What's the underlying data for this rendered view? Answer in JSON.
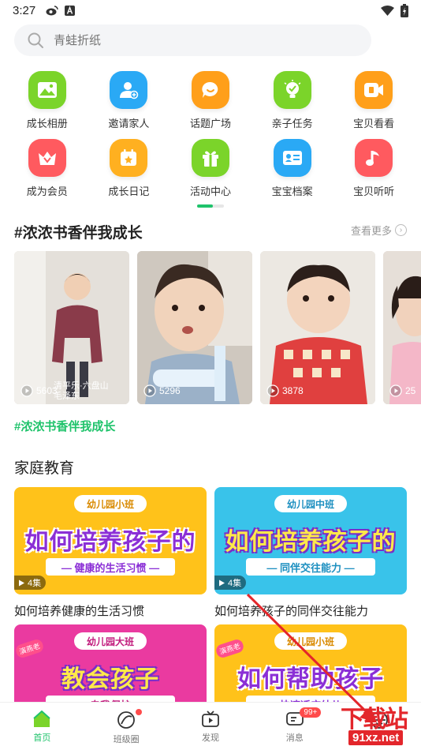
{
  "status_bar": {
    "time": "3:27"
  },
  "search": {
    "placeholder": "青蛙折纸"
  },
  "quick_grid": [
    {
      "label": "成长相册",
      "icon": "photo-album-icon",
      "color": "#7bd42a"
    },
    {
      "label": "邀请家人",
      "icon": "invite-family-icon",
      "color": "#2aa9f5"
    },
    {
      "label": "话题广场",
      "icon": "topic-square-icon",
      "color": "#ff9f1a"
    },
    {
      "label": "亲子任务",
      "icon": "parent-task-icon",
      "color": "#7bd42a"
    },
    {
      "label": "宝贝看看",
      "icon": "baby-watch-icon",
      "color": "#ff9f1a"
    },
    {
      "label": "成为会员",
      "icon": "vip-crown-icon",
      "color": "#ff5a5f"
    },
    {
      "label": "成长日记",
      "icon": "diary-calendar-icon",
      "color": "#ffb020"
    },
    {
      "label": "活动中心",
      "icon": "gift-icon",
      "color": "#7bd42a"
    },
    {
      "label": "宝宝档案",
      "icon": "profile-card-icon",
      "color": "#2aa9f5"
    },
    {
      "label": "宝贝听听",
      "icon": "music-note-icon",
      "color": "#ff5a5f"
    }
  ],
  "topic": {
    "title": "#浓浓书香伴我成长",
    "more_label": "查看更多",
    "tag_link": "#浓浓书香伴我成长",
    "videos": [
      {
        "views": "5603",
        "caption": "清平乐·六盘山 毛泽东",
        "bg": "#d8d2cc",
        "shirt": "#8a3b4a"
      },
      {
        "views": "5296",
        "caption": "",
        "bg": "#c9c3bb",
        "shirt": "#9bb1c8"
      },
      {
        "views": "3878",
        "caption": "",
        "bg": "#ddd8d0",
        "shirt": "#e0403f"
      },
      {
        "views": "25",
        "caption": "",
        "bg": "#d7cfc8",
        "shirt": "#f4b7c8"
      }
    ]
  },
  "family_edu": {
    "title": "家庭教育",
    "courses": [
      {
        "badge": "幼儿园小班",
        "big": "如何培养孩子的",
        "sub": "— 健康的生活习惯 —",
        "episodes": "4集",
        "title": "如何培养健康的生活习惯",
        "bg": "#ffc21a",
        "big_color": "#8b2fd6",
        "stamp": ""
      },
      {
        "badge": "幼儿园中班",
        "big": "如何培养孩子的",
        "sub": "— 同伴交往能力 —",
        "episodes": "4集",
        "title": "如何培养孩子的同伴交往能力",
        "bg": "#39c3ea",
        "big_color": "#ffe94a",
        "stamp": ""
      },
      {
        "badge": "幼儿园大班",
        "big": "教会孩子",
        "sub": "自我保护",
        "episodes": "",
        "title": "",
        "bg": "#ea3aa0",
        "big_color": "#ffe94a",
        "stamp": "演燕老"
      },
      {
        "badge": "幼儿园小班",
        "big": "如何帮助孩子",
        "sub": "快速适应幼儿",
        "episodes": "",
        "title": "",
        "bg": "#ffc21a",
        "big_color": "#8b2fd6",
        "stamp": "演燕老"
      }
    ]
  },
  "bottom_nav": [
    {
      "label": "首页",
      "icon": "home-icon",
      "active": true
    },
    {
      "label": "班级圈",
      "icon": "class-circle-icon",
      "active": false
    },
    {
      "label": "发现",
      "icon": "discover-tv-icon",
      "active": false
    },
    {
      "label": "消息",
      "icon": "message-icon",
      "active": false,
      "badge": "99+"
    },
    {
      "label": "",
      "icon": "profile-icon",
      "active": false
    }
  ],
  "watermark": {
    "top": "下载站",
    "bottom": "91xz.net"
  },
  "colors": {
    "accent": "#1fc36b",
    "arrow": "#e3262b"
  }
}
